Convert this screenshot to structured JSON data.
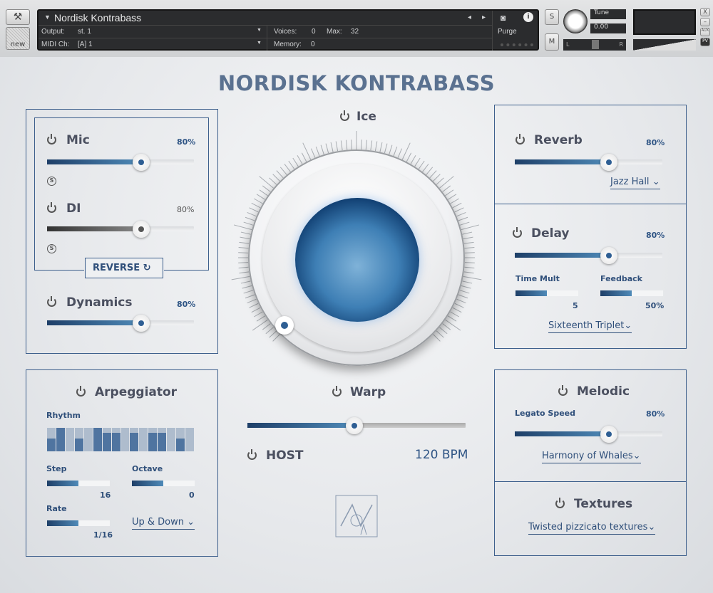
{
  "header": {
    "instrument_name": "Nordisk Kontrabass",
    "output_label": "Output:",
    "output_value": "st. 1",
    "midi_label": "MIDI Ch:",
    "midi_value": "[A]  1",
    "voices_label": "Voices:",
    "voices_value": "0",
    "max_label": "Max:",
    "max_value": "32",
    "memory_label": "Memory:",
    "memory_value": "0",
    "purge": "Purge",
    "solo": "S",
    "mute": "M",
    "tune_label": "Tune",
    "tune_value": "0.00",
    "new_label": "new",
    "pan_left": "L",
    "pan_right": "R",
    "aux": "AUX",
    "pv": "PV",
    "close": "X",
    "minimize": "–"
  },
  "title": "NORDISK KONTRABASS",
  "mic": {
    "label": "Mic",
    "value": "80%",
    "level": 0.64,
    "solo": "S"
  },
  "di": {
    "label": "DI",
    "value": "80%",
    "level": 0.64,
    "solo": "S"
  },
  "reverse": {
    "label": "REVERSE"
  },
  "dynamics": {
    "label": "Dynamics",
    "value": "80%",
    "level": 0.64
  },
  "ice": {
    "label": "Ice"
  },
  "warp": {
    "label": "Warp",
    "level": 0.49,
    "host": "HOST",
    "bpm": "120 BPM"
  },
  "reverb": {
    "label": "Reverb",
    "value": "80%",
    "level": 0.64,
    "preset": "Jazz Hall"
  },
  "delay": {
    "label": "Delay",
    "value": "80%",
    "level": 0.64,
    "time_mult_label": "Time Mult",
    "time_mult_value": "5",
    "time_mult_level": 0.5,
    "feedback_label": "Feedback",
    "feedback_value": "50%",
    "feedback_level": 0.5,
    "sync": "Sixteenth Triplet"
  },
  "arp": {
    "label": "Arpeggiator",
    "rhythm_label": "Rhythm",
    "rhythm": [
      0.55,
      1,
      0,
      0.55,
      0,
      1,
      0.8,
      0.8,
      0,
      0.8,
      0,
      0.8,
      0.8,
      0,
      0.55,
      0
    ],
    "step_label": "Step",
    "step_value": "16",
    "step_level": 0.5,
    "octave_label": "Octave",
    "octave_value": "0",
    "octave_level": 0.5,
    "rate_label": "Rate",
    "rate_value": "1/16",
    "rate_level": 0.5,
    "mode": "Up & Down"
  },
  "melodic": {
    "label": "Melodic",
    "legato_label": "Legato Speed",
    "legato_value": "80%",
    "level": 0.64,
    "preset": "Harmony of Whales"
  },
  "textures": {
    "label": "Textures",
    "preset": "Twisted pizzicato textures"
  },
  "colors": {
    "accent": "#2f5585",
    "box_border": "#3d5f8c",
    "title": "#5a7190"
  }
}
